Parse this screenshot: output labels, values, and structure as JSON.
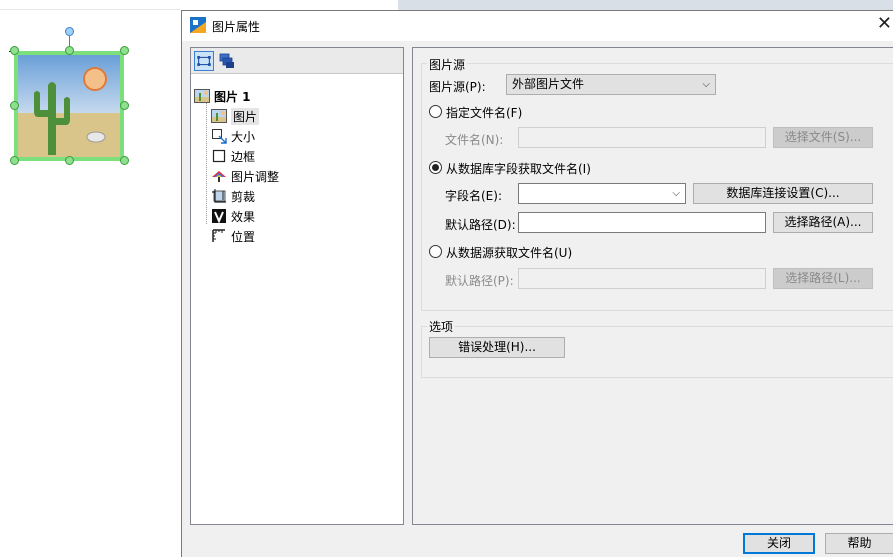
{
  "dialog": {
    "title": "图片属性",
    "close_symbol": "✕"
  },
  "tree": {
    "root_label": "图片 1",
    "items": [
      {
        "label": "图片",
        "icon": "picture-icon"
      },
      {
        "label": "大小",
        "icon": "resize-icon"
      },
      {
        "label": "边框",
        "icon": "border-icon"
      },
      {
        "label": "图片调整",
        "icon": "color-adjust-icon"
      },
      {
        "label": "剪裁",
        "icon": "crop-icon"
      },
      {
        "label": "效果",
        "icon": "effect-icon"
      },
      {
        "label": "位置",
        "icon": "position-icon"
      }
    ]
  },
  "source_group": {
    "title": "图片源",
    "source_label": "图片源(P):",
    "source_value": "外部图片文件",
    "opt_filename_label": "指定文件名(F)",
    "filename_label": "文件名(N):",
    "filename_value": "",
    "select_file_btn": "选择文件(S)...",
    "opt_db_label": "从数据库字段获取文件名(I)",
    "field_label": "字段名(E):",
    "field_value": "",
    "db_conn_btn": "数据库连接设置(C)...",
    "default_path_label": "默认路径(D):",
    "default_path_value": "",
    "select_path_btn": "选择路径(A)...",
    "opt_datasource_label": "从数据源获取文件名(U)",
    "ds_default_path_label": "默认路径(P):",
    "ds_default_path_value": "",
    "ds_select_path_btn": "选择路径(L)..."
  },
  "options_group": {
    "title": "选项",
    "error_btn": "错误处理(H)..."
  },
  "footer": {
    "close_btn": "关闭",
    "help_btn": "帮助"
  },
  "colors": {
    "selection_border": "#7be07b",
    "accent": "#0078d7"
  }
}
